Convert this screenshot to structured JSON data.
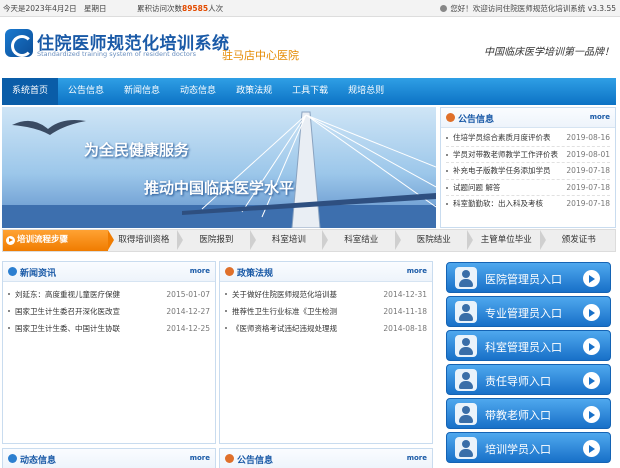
{
  "topbar": {
    "date": "今天是2023年4月2日",
    "weekday": "星期日",
    "visits_prefix": "累积访问次数",
    "visits_count": "89585",
    "visits_suffix": "人次",
    "welcome": "您好！欢迎访问住院医师规范化培训系统 v3.3.55"
  },
  "header": {
    "title": "住院医师规范化培训系统",
    "subtitle": "Standardized training system of resident doctors",
    "hospital": "驻马店中心医院",
    "slogan": "中国临床医学培训第一品牌！"
  },
  "nav": {
    "items": [
      "系统首页",
      "公告信息",
      "新闻信息",
      "动态信息",
      "政策法规",
      "工具下载",
      "规培总则"
    ]
  },
  "banner": {
    "line1": "为全民健康服务",
    "line2": "推动中国临床医学水平"
  },
  "notice": {
    "title": "公告信息",
    "more": "more",
    "items": [
      {
        "text": "住培学员综合素质月度评价表",
        "date": "2019-08-16"
      },
      {
        "text": "学员对带教老师教学工作评价表",
        "date": "2019-08-01"
      },
      {
        "text": "补充电子版教学任务添加学员",
        "date": "2019-07-18"
      },
      {
        "text": "试题问题 解答",
        "date": "2019-07-18"
      },
      {
        "text": "科室勤勤软：出入科及考核",
        "date": "2019-07-18"
      }
    ]
  },
  "process": {
    "label": "培训流程步骤",
    "steps": [
      "取得培训资格",
      "医院报到",
      "科室培训",
      "科室结业",
      "医院结业",
      "主管单位毕业",
      "颁发证书"
    ]
  },
  "news": {
    "title": "新闻资讯",
    "more": "more",
    "items": [
      {
        "text": "刘延东：高度重视儿童医疗保健",
        "date": "2015-01-07"
      },
      {
        "text": "国家卫生计生委召开深化医改宣",
        "date": "2014-12-27"
      },
      {
        "text": "国家卫生计生委、中国计生协联",
        "date": "2014-12-25"
      }
    ]
  },
  "policy": {
    "title": "政策法规",
    "more": "more",
    "items": [
      {
        "text": "关于做好住院医师规范化培训基",
        "date": "2014-12-31"
      },
      {
        "text": "推荐性卫生行业标准《卫生检测",
        "date": "2014-11-18"
      },
      {
        "text": "《医师资格考试违纪违规处理规",
        "date": "2014-08-18"
      }
    ]
  },
  "dynamics": {
    "title": "动态信息",
    "more": "more"
  },
  "notice2": {
    "title": "公告信息",
    "more": "more"
  },
  "entries": [
    "医院管理员入口",
    "专业管理员入口",
    "科室管理员入口",
    "责任导师入口",
    "带教老师入口",
    "培训学员入口"
  ]
}
